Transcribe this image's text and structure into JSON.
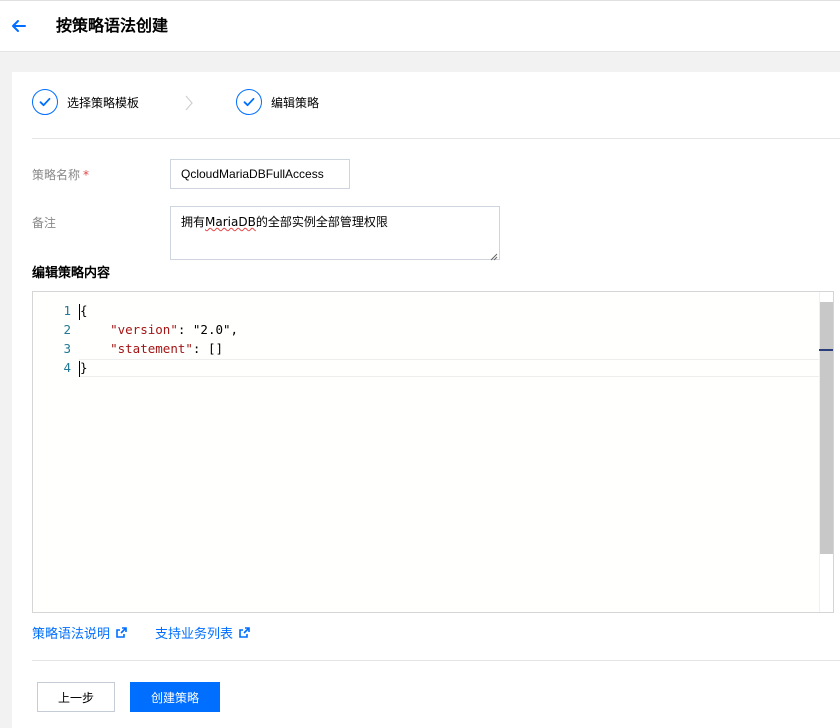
{
  "header": {
    "title": "按策略语法创建"
  },
  "steps": [
    {
      "label": "选择策略模板"
    },
    {
      "label": "编辑策略"
    }
  ],
  "form": {
    "name_label": "策略名称",
    "required_mark": "*",
    "name_value": "QcloudMariaDBFullAccess",
    "remark_label": "备注",
    "remark_parts": [
      "拥有",
      "MariaDB",
      "的全部实例全部管理权限"
    ]
  },
  "editor": {
    "title": "编辑策略内容",
    "line_numbers": [
      "1",
      "2",
      "3",
      "4"
    ],
    "lines": {
      "l1": "{",
      "l2_key": "\"version\"",
      "l2_rest": ": \"2.0\",",
      "l3_key": "\"statement\"",
      "l3_rest": ": []",
      "l4": "}"
    }
  },
  "links": {
    "syntax": "策略语法说明",
    "services": "支持业务列表"
  },
  "buttons": {
    "prev": "上一步",
    "create": "创建策略"
  },
  "colors": {
    "accent": "#006eff",
    "required": "#e54545"
  },
  "icons": [
    "arrow-left-icon",
    "check-icon",
    "chevron-right-icon",
    "external-link-icon"
  ]
}
